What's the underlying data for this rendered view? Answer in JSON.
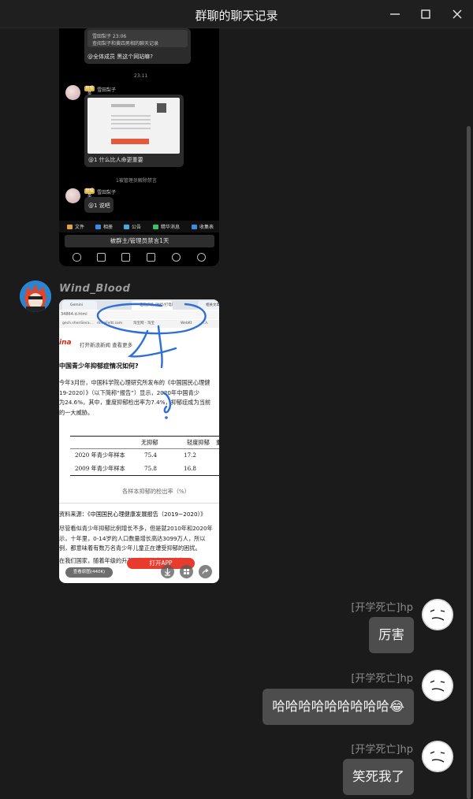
{
  "window": {
    "title": "群聊的聊天记录",
    "controls": [
      "minimize-icon",
      "maximize-icon",
      "close-icon"
    ]
  },
  "screenshot1": {
    "quote": {
      "sender": "雪田梨子 23:06",
      "quoted_text": "查阅梨子和黄四男相的聊天记录",
      "message": "@全体成员 黑这个网站嘛?"
    },
    "time": "23:11",
    "msg1": {
      "tag": "管理员",
      "name": "雪田梨子",
      "doc_text": "@1 什么比人命更重要"
    },
    "system_notice": "1被管理员解除禁言",
    "msg2": {
      "tag": "管理员",
      "name": "雪田梨子",
      "text": "@1 说吧"
    },
    "toolbar": [
      "文件",
      "相册",
      "公告",
      "精华消息",
      "收集表"
    ],
    "banned_text": "被群主/管理员禁言1天"
  },
  "sender": {
    "name": "Wind_Blood"
  },
  "screenshot2": {
    "tabs": [
      "Gemini",
      "临洮护杨 (独行/打电影的)",
      "相关文章"
    ],
    "address": "34864.d.html",
    "bookmarks": [
      "gech.shenSiera...",
      "mineFeitt.com",
      "淘宝网 - 淘宝",
      "WebKt",
      "人人"
    ],
    "brand": "ina",
    "brand_tagline": "打开新浪新闻 查看更多",
    "headline": "中国青少年抑郁症情况如何?",
    "paragraph": [
      "今年3月份，中国科学院心理研究所发布的《中国国民心理健",
      "19-2020）》（以下简称“报告”）显示，2020年中国青少",
      "为24.6%，其中，重度抑郁检出率为7.4%，抑郁症成为当前",
      "的一大威胁。"
    ],
    "table": {
      "headers": [
        "无抑郁",
        "轻度抑郁",
        "重"
      ],
      "rows": [
        {
          "label": "2020 年青少年样本",
          "values": [
            "75.4",
            "17.2"
          ]
        },
        {
          "label": "2009 年青少年样本",
          "values": [
            "75.8",
            "16.8"
          ]
        }
      ]
    },
    "caption": "各样本抑郁的检出率（%）",
    "source": "资料来源：《中国国民心理健康发展报告（2019~2020）》",
    "paragraph2": [
      "尽管看似青少年抑郁比例增长不多，但是就2010年和2020年",
      "示，十年里，0-14岁的人口数量增长高达3099万人，所以",
      "例，都意味着有数万名青少年儿童正在遭受抑郁的困扰。",
      "在我们国家，随着年级的升高，抑郁检出率也发生"
    ],
    "open_app": "打开APP",
    "view_original": "查看原图(440K)"
  },
  "right_messages": [
    {
      "name": "[开学死亡]hp",
      "text": "厉害"
    },
    {
      "name": "[开学死亡]hp",
      "text": "哈哈哈哈哈哈哈哈哈😂"
    },
    {
      "name": "[开学死亡]hp",
      "text": "笑死我了"
    }
  ]
}
